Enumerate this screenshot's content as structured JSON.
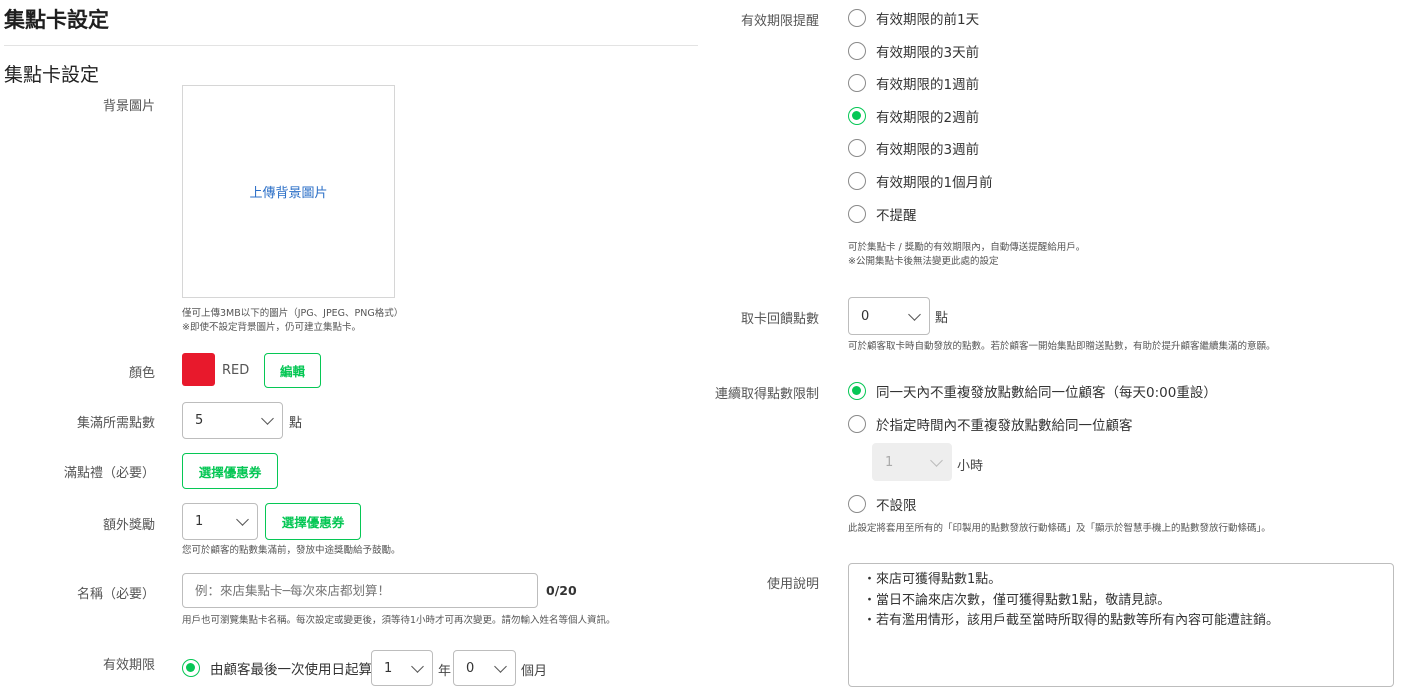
{
  "page_title": "集點卡設定",
  "section_title": "集點卡設定",
  "background_image": {
    "label": "背景圖片",
    "upload_link": "上傳背景圖片",
    "hint_1": "僅可上傳3MB以下的圖片（JPG、JPEG、PNG格式）",
    "hint_2": "※即使不設定背景圖片，仍可建立集點卡。"
  },
  "color": {
    "label": "顏色",
    "value": "RED",
    "swatch": "#e8192c",
    "edit_label": "編輯"
  },
  "points_required": {
    "label": "集滿所需點數",
    "value": "5",
    "unit": "點"
  },
  "full_reward": {
    "label": "滿點禮（必要）",
    "button": "選擇優惠券"
  },
  "extra_reward": {
    "label": "額外獎勵",
    "value": "1",
    "button": "選擇優惠券",
    "hint": "您可於顧客的點數集滿前，發放中途獎勵給予鼓勵。"
  },
  "name": {
    "label": "名稱（必要）",
    "placeholder": "例：來店集點卡─每次來店都划算！",
    "counter": "0/20",
    "hint": "用戶也可瀏覽集點卡名稱。每次設定或變更後，須等待1小時才可再次變更。請勿輸入姓名等個人資訊。"
  },
  "validity": {
    "label": "有效期限",
    "option": "由顧客最後一次使用日起算",
    "years": "1",
    "year_unit": "年",
    "months": "0",
    "month_unit": "個月"
  },
  "expiry_reminder": {
    "label": "有效期限提醒",
    "options": [
      "有效期限的前1天",
      "有效期限的3天前",
      "有效期限的1週前",
      "有效期限的2週前",
      "有效期限的3週前",
      "有效期限的1個月前",
      "不提醒"
    ],
    "selected_index": 3,
    "hint_1": "可於集點卡 / 獎勵的有效期限內，自動傳送提醒給用戶。",
    "hint_2": "※公開集點卡後無法變更此處的設定"
  },
  "welcome_points": {
    "label": "取卡回饋點數",
    "value": "0",
    "unit": "點",
    "hint": "可於顧客取卡時自動發放的點數。若於顧客一開始集點即贈送點數，有助於提升顧客繼續集滿的意願。"
  },
  "consecutive_limit": {
    "label": "連續取得點數限制",
    "option_1": "同一天內不重複發放點數給同一位顧客（每天0:00重設）",
    "option_2": "於指定時間內不重複發放點數給同一位顧客",
    "hours_value": "1",
    "hours_unit": "小時",
    "option_3": "不設限",
    "selected_index": 0,
    "hint": "此設定將套用至所有的「印製用的點數發放行動條碼」及「顯示於智慧手機上的點數發放行動條碼」。"
  },
  "usage_notes": {
    "label": "使用說明",
    "lines": [
      "・來店可獲得點數1點。",
      "・當日不論來店次數，僅可獲得點數1點，敬請見諒。",
      "・若有濫用情形，該用戶截至當時所取得的點數等所有內容可能遭註銷。"
    ]
  },
  "colors": {
    "accent": "#06c755",
    "link": "#2b6fc7"
  }
}
